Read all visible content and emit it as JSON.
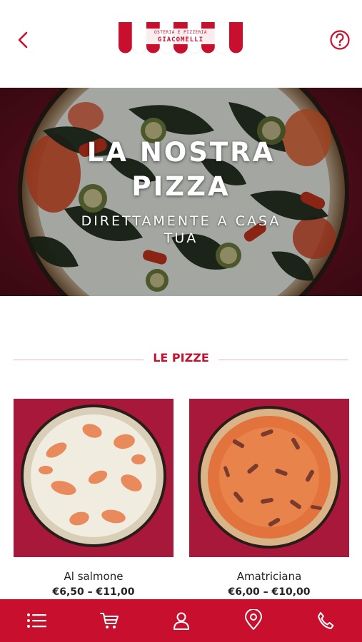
{
  "header": {
    "logo_subtitle": "OSTERIA E PIZZERIA",
    "logo_name": "GIACOMELLI"
  },
  "hero": {
    "title_line1": "LA NOSTRA",
    "title_line2": "PIZZA",
    "subtitle": "DIRETTAMENTE A CASA TUA"
  },
  "section": {
    "title": "LE PIZZE"
  },
  "products": [
    {
      "name": "Al salmone",
      "price": "€6,50 – €11,00"
    },
    {
      "name": "Amatriciana",
      "price": "€6,00 – €10,00"
    }
  ],
  "tabbar": {
    "items": [
      "menu-icon",
      "cart-icon",
      "user-icon",
      "location-icon",
      "phone-icon"
    ]
  },
  "colors": {
    "accent": "#c8102e",
    "background": "#ffffff",
    "text": "#222222"
  }
}
